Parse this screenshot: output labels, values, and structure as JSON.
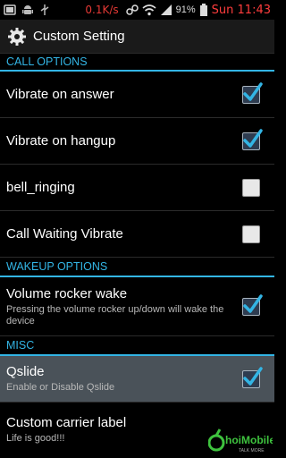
{
  "status_bar": {
    "net_speed": "0.1K/s",
    "battery_pct": "91%",
    "time": "Sun 11:43"
  },
  "action_bar": {
    "title": "Custom Setting",
    "icon": "gear-icon"
  },
  "categories": {
    "call_options": "CALL OPTIONS",
    "wakeup_options": "WAKEUP OPTIONS",
    "misc": "MISC"
  },
  "prefs": {
    "vibrate_answer": {
      "title": "Vibrate on answer",
      "checked": true
    },
    "vibrate_hangup": {
      "title": "Vibrate on hangup",
      "checked": true
    },
    "bell_ringing": {
      "title": "bell_ringing",
      "checked": false
    },
    "call_waiting": {
      "title": "Call Waiting Vibrate",
      "checked": false
    },
    "volume_wake": {
      "title": "Volume rocker wake",
      "summary": "Pressing the volume rocker up/down will wake the device",
      "checked": true
    },
    "qslide": {
      "title": "Qslide",
      "summary": "Enable or Disable Qslide",
      "checked": true
    },
    "carrier_label": {
      "title": "Custom carrier label",
      "summary": "Life is good!!!"
    }
  },
  "watermark": {
    "text": "hoiMobile",
    "tagline": "TALK MORE"
  },
  "colors": {
    "accent": "#33b5e5",
    "status_red": "#ff3d3d",
    "highlight_row": "#4a5259"
  }
}
